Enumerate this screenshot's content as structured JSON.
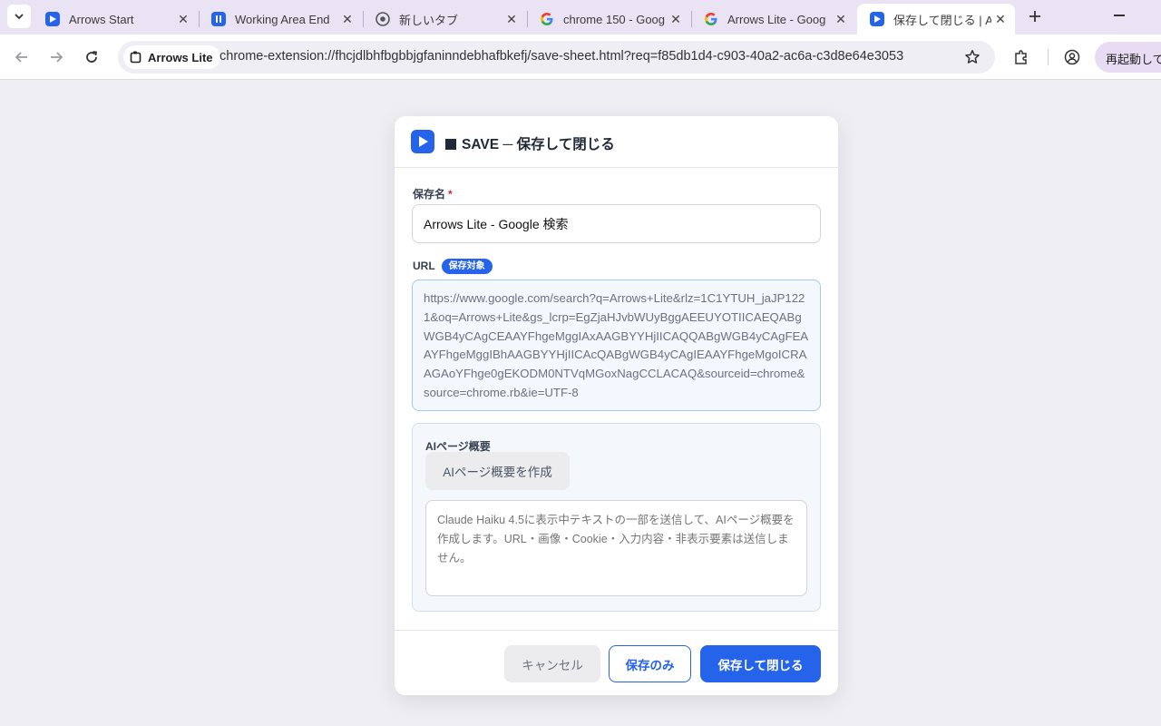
{
  "browser": {
    "tabs": [
      {
        "title": "Arrows Start",
        "favicon": "arrows-play-icon"
      },
      {
        "title": "Working Area End",
        "favicon": "arrows-pause-icon"
      },
      {
        "title": "新しいタブ",
        "favicon": "chrome-icon"
      },
      {
        "title": "chrome 150 - Goog",
        "favicon": "google-icon"
      },
      {
        "title": "Arrows Lite - Goog",
        "favicon": "google-icon"
      },
      {
        "title": "保存して閉じる | Arr",
        "favicon": "arrows-play-icon",
        "active": true
      }
    ],
    "site_chip": "Arrows Lite",
    "url": "chrome-extension://fhcjdlbhfbgbbjgfaninndebhafbkefj/save-sheet.html?req=f85db1d4-c903-40a2-ac6a-c3d8e64e3053",
    "restart_label": "再起動して更新"
  },
  "dialog": {
    "title": "SAVE ─ 保存して閉じる",
    "name_label": "保存名",
    "required_mark": "*",
    "name_value": "Arrows Lite - Google 検索",
    "url_label": "URL",
    "url_badge": "保存対象",
    "url_value": "https://www.google.com/search?q=Arrows+Lite&rlz=1C1YTUH_jaJP1221&oq=Arrows+Lite&gs_lcrp=EgZjaHJvbWUyBggAEEUYOTIICAEQABgWGB4yCAgCEAAYFhgeMggIAxAAGBYYHjIICAQQABgWGB4yCAgFEAAYFhgeMggIBhAAGBYYHjIICAcQABgWGB4yCAgIEAAYFhgeMgoICRAAGAoYFhge0gEKODM0NTVqMGoxNagCCLACAQ&sourceid=chrome&source=chrome.rb&ie=UTF-8",
    "ai_label": "AIページ概要",
    "ai_button": "AIページ概要を作成",
    "ai_placeholder": "Claude Haiku 4.5に表示中テキストの一部を送信して、AIページ概要を作成します。URL・画像・Cookie・入力内容・非表示要素は送信しません。",
    "buttons": {
      "cancel": "キャンセル",
      "save_only": "保存のみ",
      "save_close": "保存して閉じる"
    }
  },
  "colors": {
    "accent": "#2563eb",
    "tabstrip": "#e9e3f3",
    "page_bg": "#eeeef3"
  }
}
